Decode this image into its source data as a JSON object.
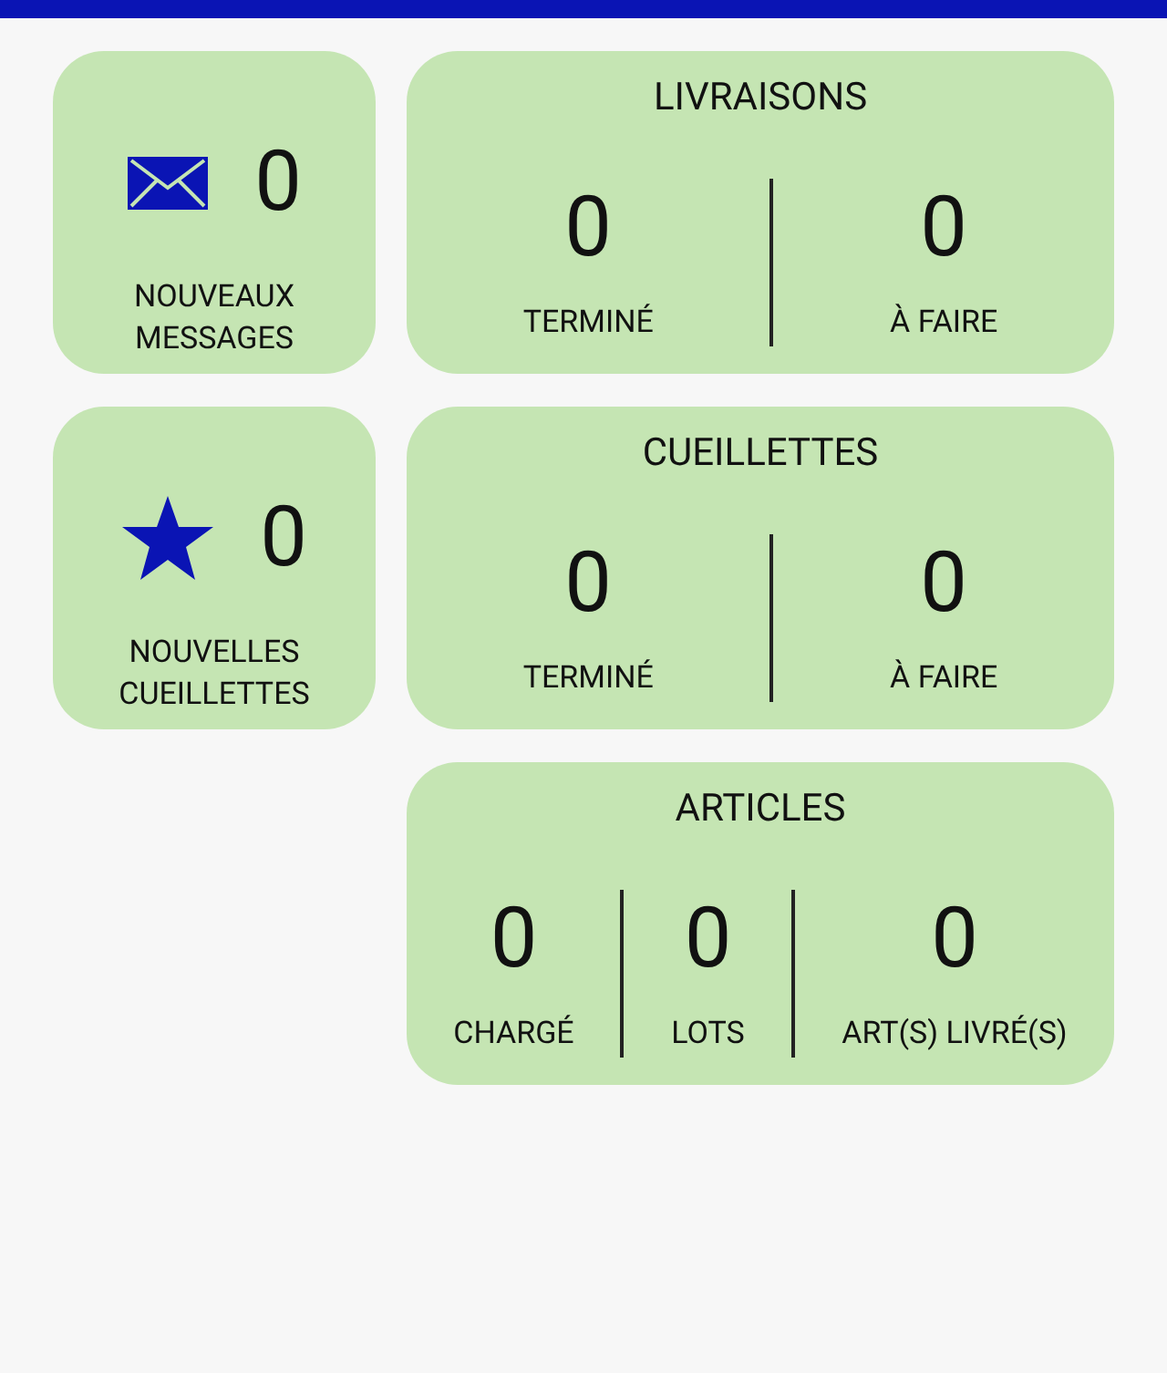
{
  "summary_cards": [
    {
      "kind": "messages",
      "count": "0",
      "label": "NOUVEAUX MESSAGES"
    },
    {
      "kind": "picks",
      "count": "0",
      "label": "NOUVELLES CUEILLETTES"
    }
  ],
  "stat_cards": [
    {
      "title": "LIVRAISONS",
      "stats": [
        {
          "value": "0",
          "label": "TERMINÉ"
        },
        {
          "value": "0",
          "label": "À FAIRE"
        }
      ]
    },
    {
      "title": "CUEILLETTES",
      "stats": [
        {
          "value": "0",
          "label": "TERMINÉ"
        },
        {
          "value": "0",
          "label": "À FAIRE"
        }
      ]
    },
    {
      "title": "ARTICLES",
      "stats": [
        {
          "value": "0",
          "label": "CHARGÉ"
        },
        {
          "value": "0",
          "label": "LOTS"
        },
        {
          "value": "0",
          "label": "ART(S) LIVRÉ(S)"
        }
      ]
    }
  ]
}
